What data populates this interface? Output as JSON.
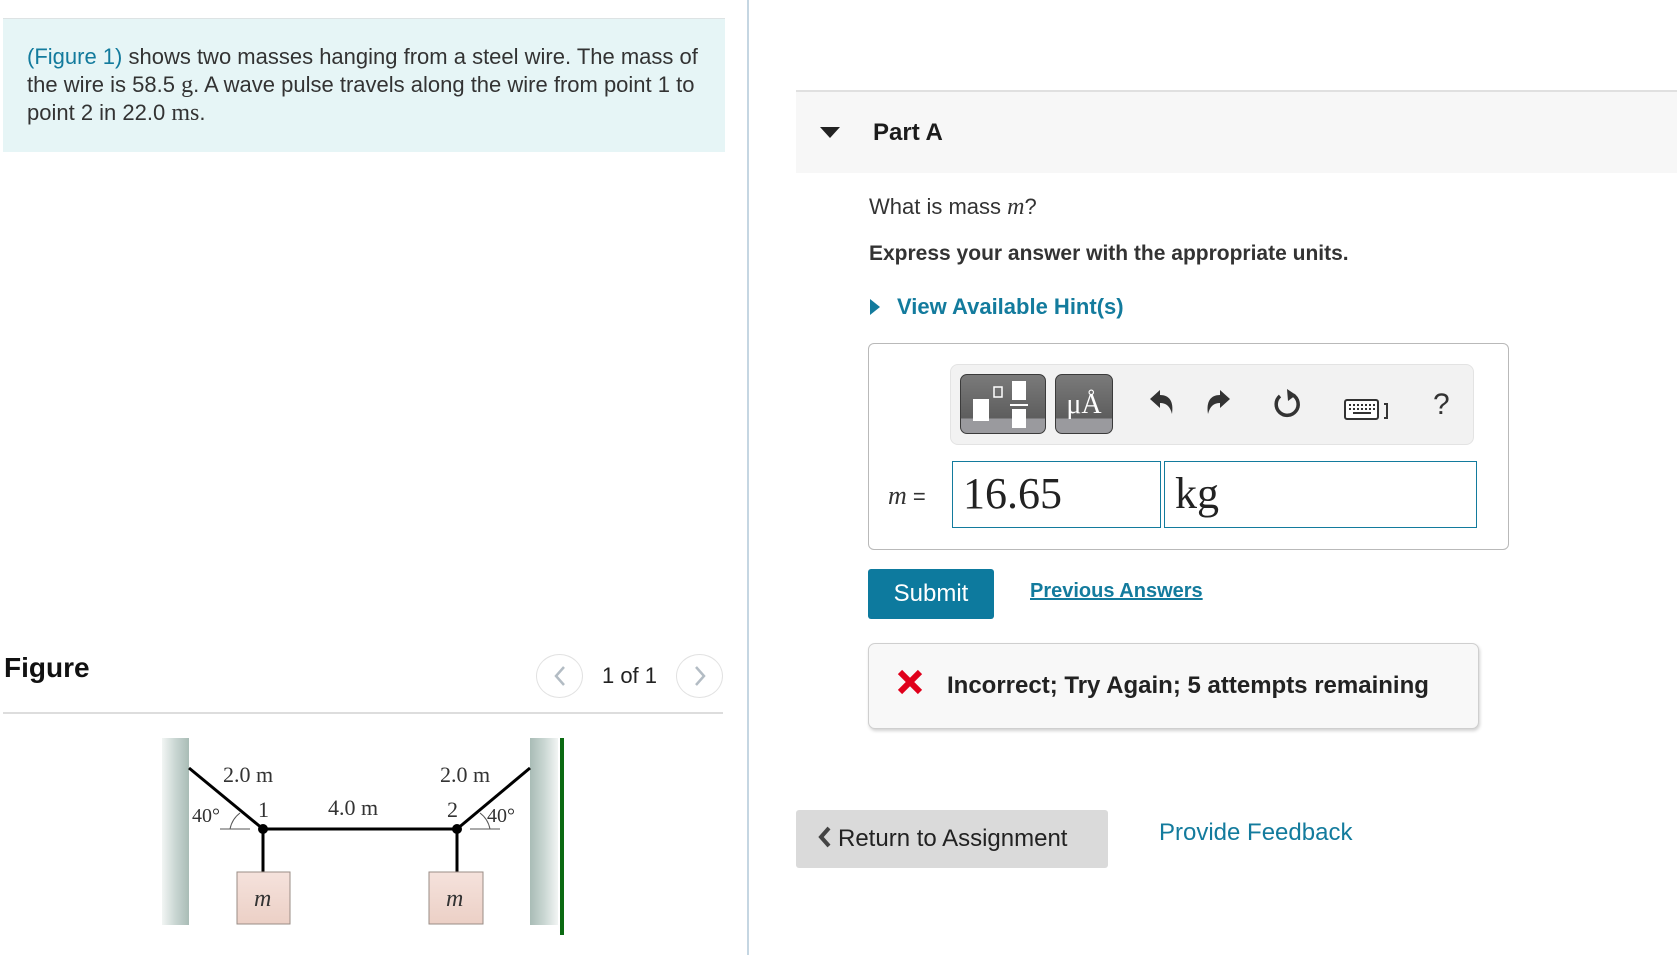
{
  "intro": {
    "figure_link": "(Figure 1)",
    "text_1": " shows two masses hanging from a steel wire. The mass of the wire is 58.5 ",
    "unit_g": "g",
    "text_2": ". A wave pulse travels along the wire from point 1 to point 2 in 22.0 ",
    "unit_ms": "ms",
    "text_3": "."
  },
  "figure_panel": {
    "title": "Figure",
    "pager": "1 of 1",
    "prev_icon": "chevron-left-icon",
    "next_icon": "chevron-right-icon",
    "diagram": {
      "left_segment_label": "2.0 m",
      "middle_segment_label": "4.0 m",
      "right_segment_label": "2.0 m",
      "left_angle_label": "40°",
      "right_angle_label": "40°",
      "point_1_label": "1",
      "point_2_label": "2",
      "mass_left_label": "m",
      "mass_right_label": "m"
    }
  },
  "part": {
    "title": "Part A",
    "question_prefix": "What is mass ",
    "question_var": "m",
    "question_suffix": "?",
    "instructions": "Express your answer with the appropriate units.",
    "hint_label": "View Available Hint(s)"
  },
  "answer": {
    "toolbar": {
      "templates_icon": "fraction-template-icon",
      "units_label": "μÅ",
      "undo_icon": "undo-icon",
      "redo_icon": "redo-icon",
      "reset_icon": "reset-icon",
      "keyboard_icon": "keyboard-icon",
      "help_label": "?"
    },
    "variable": "m",
    "equals": " =",
    "value": "16.65",
    "unit": "kg"
  },
  "actions": {
    "submit_label": "Submit",
    "previous_answers_label": "Previous Answers"
  },
  "feedback": {
    "status_icon": "incorrect-x-icon",
    "message": "Incorrect; Try Again; 5 attempts remaining"
  },
  "footer": {
    "return_label": "Return to Assignment",
    "provide_feedback_label": "Provide Feedback"
  },
  "colors": {
    "accent": "#137b9d",
    "submit_bg": "#0d7a9e",
    "error": "#e0001b",
    "intro_bg": "#e6f5f6"
  }
}
